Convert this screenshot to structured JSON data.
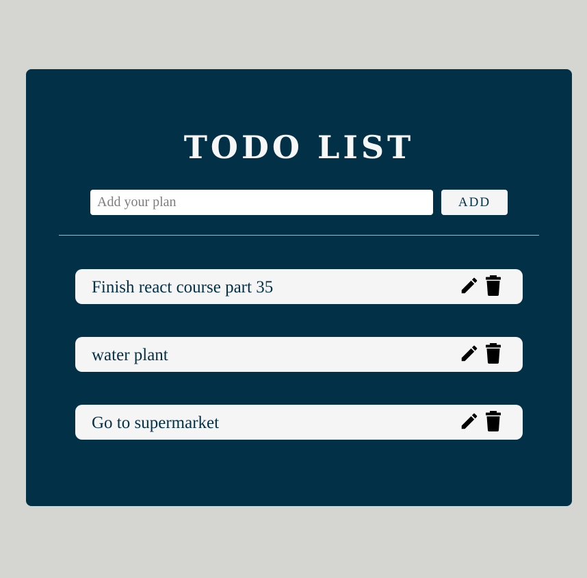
{
  "app": {
    "title": "TODO LIST"
  },
  "form": {
    "input_value": "",
    "input_placeholder": "Add your plan",
    "add_label": "ADD"
  },
  "todos": [
    {
      "text": "Finish react course part 35",
      "edit_icon": "pencil-icon",
      "delete_icon": "trash-icon"
    },
    {
      "text": "water plant",
      "edit_icon": "pencil-icon",
      "delete_icon": "trash-icon"
    },
    {
      "text": "Go to supermarket",
      "edit_icon": "pencil-icon",
      "delete_icon": "trash-icon"
    }
  ],
  "colors": {
    "page_background": "#d5d6d1",
    "panel_background": "#023047",
    "item_background": "#f5f5f6",
    "title_text": "#f7f7f7",
    "item_text": "#023047"
  }
}
